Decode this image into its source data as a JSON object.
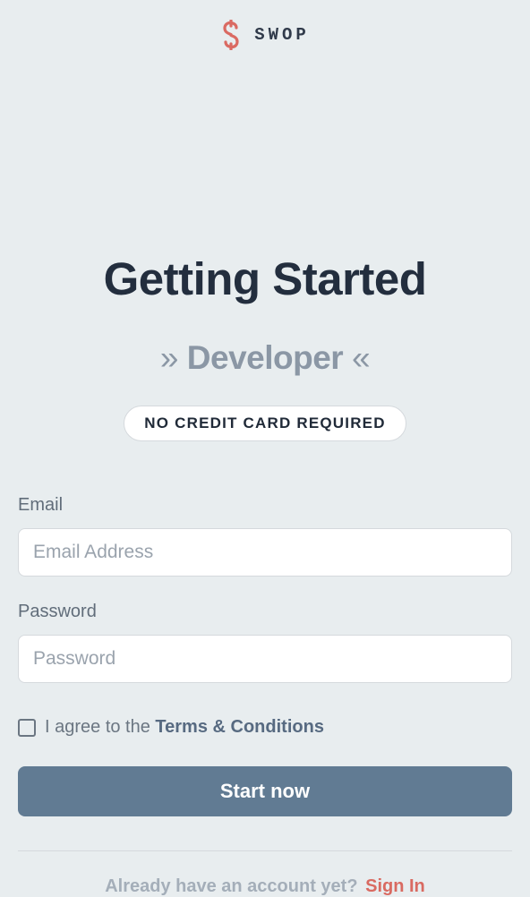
{
  "brand": {
    "name": "SWOP"
  },
  "heading": "Getting Started",
  "subheading": {
    "leftArrow": "»",
    "text": "Developer",
    "rightArrow": "«"
  },
  "badge": "NO CREDIT CARD REQUIRED",
  "form": {
    "email": {
      "label": "Email",
      "placeholder": "Email Address",
      "value": ""
    },
    "password": {
      "label": "Password",
      "placeholder": "Password",
      "value": ""
    },
    "agree": {
      "text": "I agree to the ",
      "link": "Terms & Conditions",
      "checked": false
    },
    "submit": "Start now"
  },
  "signin": {
    "prompt": "Already have an account yet?",
    "link": "Sign In"
  }
}
